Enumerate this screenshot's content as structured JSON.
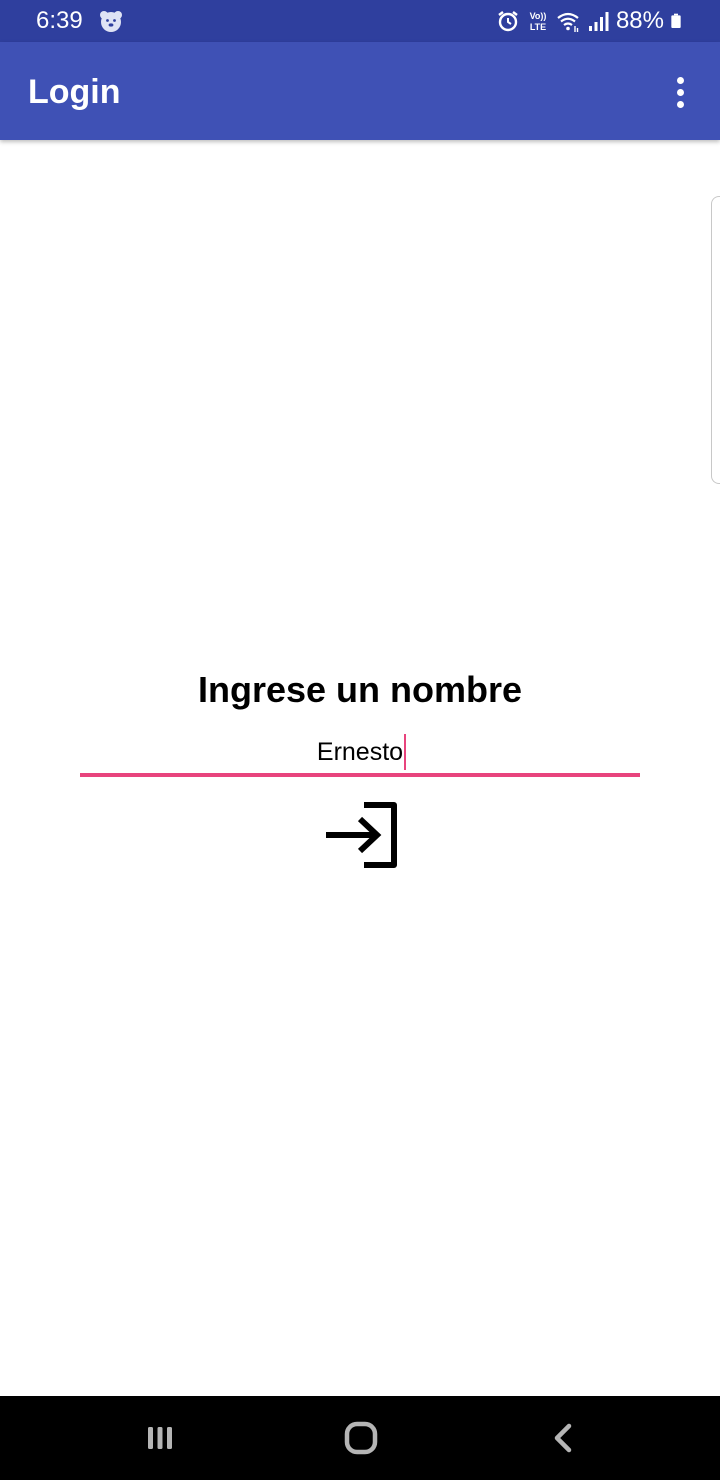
{
  "status_bar": {
    "time": "6:39",
    "battery": "88%",
    "left_icon": "notification-bear-icon",
    "right_icons": [
      "alarm-icon",
      "volte-icon",
      "wifi-icon",
      "signal-icon",
      "battery-icon"
    ],
    "volte_top": "Vo))",
    "volte_bottom": "LTE"
  },
  "app_bar": {
    "title": "Login",
    "menu_icon": "overflow-menu-icon",
    "color": "#3f51b5"
  },
  "main": {
    "prompt": "Ingrese un nombre",
    "name_input": {
      "value": "Ernesto",
      "accent_color": "#e8447d"
    },
    "login_button_icon": "login-icon"
  },
  "nav_bar": {
    "buttons": [
      "recents-icon",
      "home-icon",
      "back-icon"
    ]
  }
}
